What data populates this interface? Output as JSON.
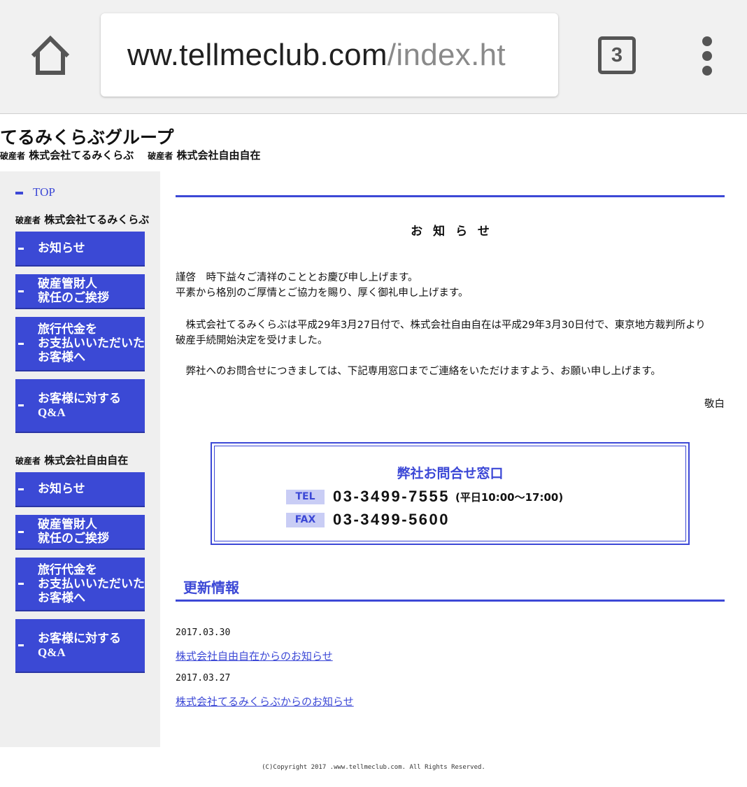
{
  "browser": {
    "url_host": "ww.tellmeclub.com",
    "url_path": "/index.ht",
    "tab_count": "3",
    "icons": {
      "home": "home-icon",
      "menu": "more-vert-icon"
    }
  },
  "header": {
    "title": "てるみくらぶグループ",
    "bankrupt_label": "破産者",
    "company1": "株式会社てるみくらぶ",
    "company2": "株式会社自由自在"
  },
  "sidebar": {
    "top_link": "TOP",
    "section1": {
      "bankrupt_label": "破産者",
      "company": "株式会社てるみくらぶ",
      "items": [
        {
          "label": "お知らせ"
        },
        {
          "label": "破産管財人\n就任のご挨拶"
        },
        {
          "label": "旅行代金を\nお支払いいただいた\nお客様へ"
        },
        {
          "label": "お客様に対する\nQ&A"
        }
      ]
    },
    "section2": {
      "bankrupt_label": "破産者",
      "company": "株式会社自由自在",
      "items": [
        {
          "label": "お知らせ"
        },
        {
          "label": "破産管財人\n就任のご挨拶"
        },
        {
          "label": "旅行代金を\nお支払いいただいた\nお客様へ"
        },
        {
          "label": "お客様に対する\nQ&A"
        }
      ]
    }
  },
  "notice": {
    "title": "お知らせ",
    "greeting_line1": "謹啓　時下益々ご清祥のこととお慶び申し上げます。",
    "greeting_line2": "平素から格別のご厚情とご協力を賜り、厚く御礼申し上げます。",
    "body_line1": "　株式会社てるみくらぶは平成29年3月27日付で、株式会社自由自在は平成29年3月30日付で、東京地方裁判所より",
    "body_line2": "破産手続開始決定を受けました。",
    "inquiry": "　弊社へのお問合せにつきましては、下記専用窓口までご連絡をいただけますよう、お願い申し上げます。",
    "closing": "敬白"
  },
  "contact": {
    "title": "弊社お問合せ窓口",
    "tel_label": "TEL",
    "tel": "03-3499-7555",
    "hours": "(平日10:00～17:00)",
    "fax_label": "FAX",
    "fax": "03-3499-5600"
  },
  "updates": {
    "title": "更新情報",
    "items": [
      {
        "date": "2017.03.30",
        "link": "株式会社自由自在からのお知らせ"
      },
      {
        "date": "2017.03.27",
        "link": "株式会社てるみくらぶからのお知らせ"
      }
    ]
  },
  "footer": {
    "copyright": "(C)Copyright 2017 .www.tellmeclub.com. All Rights Reserved."
  },
  "colors": {
    "accent": "#3c48d6",
    "sidebar_bg": "#efefef",
    "chrome_bg": "#f1f1f1"
  }
}
